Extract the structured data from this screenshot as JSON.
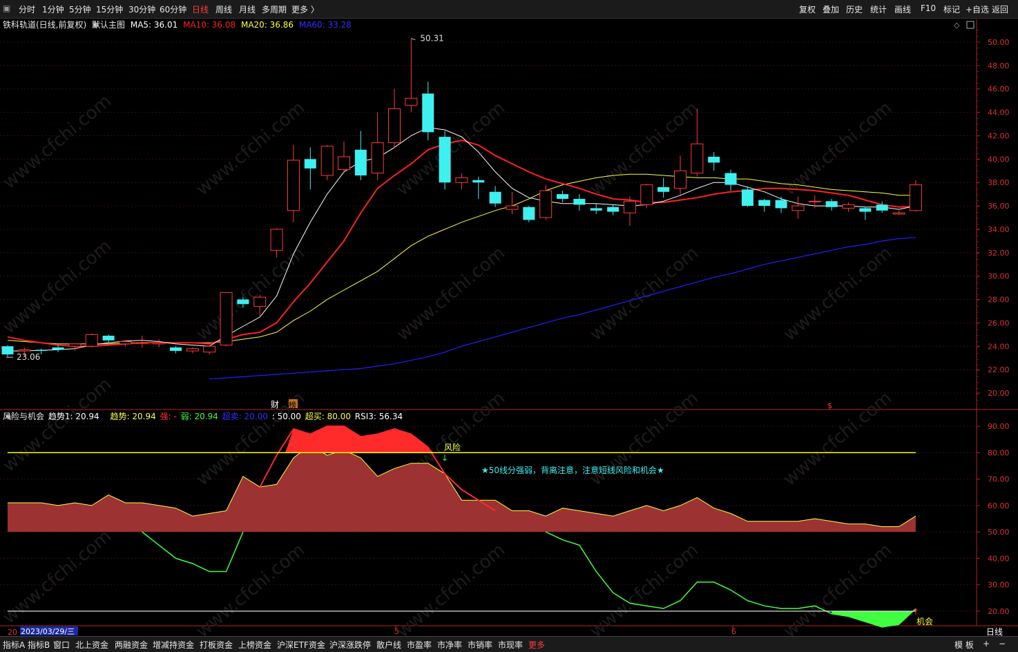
{
  "toolbar": {
    "left": [
      "分时",
      "1分钟",
      "5分钟",
      "15分钟",
      "30分钟",
      "60分钟",
      "日线",
      "周线",
      "月线",
      "多周期",
      "更多 〉"
    ],
    "right": [
      "复权",
      "叠加",
      "历史",
      "统计",
      "画线",
      "F10",
      "标记",
      "+自选",
      "返回"
    ],
    "active": "日线"
  },
  "chart": {
    "stock": "铁科轨道(日线,前复权)",
    "template": "默认主图",
    "ma5": "MA5: 36.01",
    "ma10": "MA10: 36.08",
    "ma20": "MA20: 36.86",
    "ma60": "MA60: 33.28",
    "high_label": "50.31",
    "low_label": "23.06",
    "marks": [
      "财",
      "榜",
      "$"
    ],
    "price_ticks": [
      "50.00",
      "48.00",
      "46.00",
      "44.00",
      "42.00",
      "40.00",
      "38.00",
      "36.00",
      "34.00",
      "32.00",
      "30.00",
      "28.00",
      "26.00",
      "24.00",
      "22.00",
      "20.00"
    ],
    "watermark": "www.cfchi.com"
  },
  "indicator": {
    "name": "风险与机会",
    "trend1": "趋势1: 20.94",
    "trend": "趋势: 20.94",
    "strong": "强: -",
    "weak": "弱: 20.94",
    "oversold": "超卖: 20.00",
    "mid": ": 50.00",
    "overbought": "超买: 80.00",
    "rsi3": "RSI3: 56.34",
    "ticks": [
      "90.00",
      "80.00",
      "70.00",
      "60.00",
      "50.00",
      "40.00",
      "30.00",
      "20.00"
    ],
    "risk_label": "风险",
    "chance_label": "机会",
    "note": "★50线分强弱，背离注意，注意短线风险和机会★"
  },
  "xaxis": {
    "date": "2023/03/29/三",
    "prefix": "20",
    "month5": "5",
    "month6": "6",
    "period": "日线"
  },
  "statusbar": {
    "items": [
      "指标A",
      "指标B",
      "窗口",
      "北上资金",
      "两融资金",
      "增减持资金",
      "打板资金",
      "上榜资金",
      "沪深ETF资金",
      "沪深涨跌停",
      "散户线",
      "市盈率",
      "市净率",
      "市销率",
      "市现率",
      "更多"
    ],
    "right": [
      "模 板",
      "+",
      "−"
    ]
  },
  "colors": {
    "up": "#ff3b3b",
    "down": "#3ef0f0",
    "ma5": "#ffffff",
    "ma10": "#ff2020",
    "ma20": "#ffff40",
    "ma60": "#2020ff",
    "area": "#9c3232",
    "risk": "#ff2a2a",
    "weak_line": "#40ff40",
    "overbought_line": "#ffff00"
  },
  "chart_data": {
    "type": "candlestick",
    "candles": [
      [
        24.0,
        23.3,
        24.1,
        23.1
      ],
      [
        23.6,
        23.7,
        23.9,
        23.1
      ],
      [
        23.7,
        23.6,
        23.8,
        23.3
      ],
      [
        23.9,
        23.7,
        24.1,
        23.5
      ],
      [
        24.0,
        24.2,
        24.2,
        23.6
      ],
      [
        24.0,
        25.0,
        25.1,
        23.9
      ],
      [
        24.9,
        24.5,
        25.0,
        24.3
      ],
      [
        24.2,
        24.4,
        24.5,
        24.0
      ],
      [
        24.3,
        24.3,
        24.9,
        23.9
      ],
      [
        24.2,
        24.3,
        24.6,
        23.9
      ],
      [
        23.9,
        23.6,
        24.0,
        23.4
      ],
      [
        23.6,
        23.8,
        23.9,
        23.4
      ],
      [
        23.5,
        24.0,
        24.1,
        23.3
      ],
      [
        24.1,
        28.6,
        28.6,
        24.0
      ],
      [
        28.0,
        27.6,
        28.2,
        27.3
      ],
      [
        27.4,
        28.2,
        28.4,
        26.6
      ],
      [
        32.2,
        34.0,
        34.1,
        31.6
      ],
      [
        35.6,
        39.9,
        41.2,
        34.6
      ],
      [
        40.0,
        39.2,
        41.0,
        37.4
      ],
      [
        38.6,
        41.1,
        41.2,
        38.2
      ],
      [
        39.1,
        40.2,
        41.5,
        38.8
      ],
      [
        40.8,
        38.6,
        42.4,
        38.2
      ],
      [
        38.8,
        41.4,
        44.0,
        38.2
      ],
      [
        41.4,
        44.3,
        46.0,
        41.0
      ],
      [
        44.6,
        45.2,
        50.31,
        44.0
      ],
      [
        45.6,
        42.3,
        46.6,
        41.6
      ],
      [
        41.9,
        38.0,
        42.4,
        37.4
      ],
      [
        38.0,
        38.4,
        38.8,
        37.4
      ],
      [
        38.2,
        38.0,
        38.5,
        36.6
      ],
      [
        37.2,
        36.2,
        37.7,
        35.9
      ],
      [
        35.7,
        36.0,
        37.2,
        35.3
      ],
      [
        35.9,
        34.8,
        36.0,
        34.6
      ],
      [
        35.0,
        37.3,
        37.8,
        34.8
      ],
      [
        37.0,
        36.6,
        37.3,
        36.3
      ],
      [
        36.6,
        36.1,
        37.0,
        35.6
      ],
      [
        35.8,
        35.6,
        36.2,
        35.3
      ],
      [
        35.9,
        35.5,
        36.1,
        35.2
      ],
      [
        35.4,
        36.4,
        36.8,
        34.3
      ],
      [
        36.1,
        37.8,
        37.9,
        35.8
      ],
      [
        37.6,
        37.2,
        38.4,
        36.7
      ],
      [
        37.5,
        39.0,
        40.3,
        36.8
      ],
      [
        38.8,
        41.3,
        44.3,
        38.5
      ],
      [
        40.2,
        39.7,
        40.6,
        39.0
      ],
      [
        38.8,
        37.8,
        39.1,
        37.3
      ],
      [
        37.4,
        36.0,
        37.6,
        35.9
      ],
      [
        36.5,
        36.0,
        36.6,
        35.5
      ],
      [
        36.5,
        35.8,
        36.8,
        35.4
      ],
      [
        35.6,
        36.0,
        36.8,
        34.9
      ],
      [
        36.4,
        36.4,
        36.9,
        35.8
      ],
      [
        36.4,
        35.9,
        36.6,
        35.6
      ],
      [
        35.8,
        36.1,
        36.3,
        35.5
      ],
      [
        35.8,
        35.5,
        35.9,
        34.8
      ],
      [
        36.1,
        35.6,
        36.4,
        35.4
      ],
      [
        35.3,
        35.4,
        35.6,
        35.2
      ],
      [
        35.6,
        37.8,
        38.2,
        35.5
      ]
    ],
    "ma5": [
      23.6,
      23.6,
      23.65,
      23.7,
      23.8,
      24.1,
      24.3,
      24.45,
      24.5,
      24.4,
      24.2,
      24.1,
      24.0,
      24.9,
      25.7,
      26.5,
      28.3,
      31.9,
      34.6,
      37.0,
      38.9,
      39.8,
      40.1,
      41.0,
      42.0,
      42.7,
      42.5,
      41.9,
      40.6,
      38.9,
      37.5,
      36.7,
      36.4,
      36.2,
      36.2,
      36.2,
      36.1,
      36.0,
      36.1,
      36.4,
      36.9,
      37.5,
      38.0,
      38.0,
      37.6,
      37.2,
      36.6,
      36.2,
      36.0,
      36.0,
      36.0,
      35.9,
      35.9,
      35.7,
      36.0
    ],
    "ma10": [
      24.8,
      24.5,
      24.3,
      24.1,
      24.0,
      24.0,
      24.1,
      24.2,
      24.3,
      24.3,
      24.3,
      24.3,
      24.2,
      24.6,
      25.0,
      25.2,
      26.0,
      27.8,
      29.4,
      31.2,
      33.0,
      35.4,
      37.5,
      38.6,
      39.6,
      40.8,
      41.3,
      41.6,
      41.2,
      40.3,
      39.6,
      38.9,
      38.3,
      37.9,
      37.5,
      37.0,
      36.6,
      36.5,
      36.3,
      36.3,
      36.5,
      36.7,
      37.0,
      37.2,
      37.3,
      37.5,
      37.5,
      37.4,
      37.3,
      37.1,
      36.9,
      36.5,
      36.1,
      35.9,
      35.95
    ],
    "ma20": [
      24.5,
      24.4,
      24.3,
      24.2,
      24.2,
      24.2,
      24.2,
      24.3,
      24.3,
      24.3,
      24.3,
      24.3,
      24.3,
      24.4,
      24.6,
      24.8,
      25.2,
      26.2,
      27.0,
      28.0,
      28.8,
      29.6,
      30.4,
      31.5,
      32.6,
      33.4,
      34.0,
      34.6,
      35.1,
      35.6,
      36.0,
      36.6,
      37.3,
      37.8,
      38.1,
      38.4,
      38.6,
      38.7,
      38.7,
      38.6,
      38.5,
      38.4,
      38.4,
      38.3,
      38.3,
      38.1,
      37.9,
      37.8,
      37.6,
      37.4,
      37.3,
      37.2,
      37.1,
      36.9,
      36.9
    ],
    "ma60": [
      21.2,
      21.3,
      21.4,
      21.5,
      21.6,
      21.7,
      21.8,
      21.9,
      22.0,
      22.1,
      22.3,
      22.5,
      22.8,
      23.1,
      23.5,
      24.0,
      24.4,
      24.8,
      25.2,
      25.6,
      26.0,
      26.4,
      26.7,
      27.1,
      27.5,
      27.9,
      28.3,
      28.7,
      29.1,
      29.5,
      29.9,
      30.2,
      30.6,
      31.0,
      31.3,
      31.6,
      31.9,
      32.2,
      32.5,
      32.7,
      33.0,
      33.2,
      33.3
    ],
    "ma60_start": 12,
    "indicator_area": [
      61,
      61,
      61,
      60,
      61,
      60,
      64,
      61,
      61,
      60,
      59,
      56,
      57,
      58,
      71,
      67,
      68,
      78,
      83,
      79,
      81,
      78,
      71,
      74,
      76,
      76,
      72,
      62,
      62,
      62,
      58,
      58,
      56,
      59,
      58,
      57,
      56,
      58,
      60,
      58,
      60,
      63,
      59,
      57,
      54,
      54,
      54,
      54,
      55,
      54,
      53,
      53,
      52,
      52,
      56
    ],
    "risk_line": [
      null,
      null,
      null,
      null,
      null,
      null,
      null,
      null,
      null,
      null,
      null,
      null,
      null,
      null,
      null,
      67,
      79,
      89,
      87,
      90,
      90,
      86,
      87,
      89,
      87,
      82,
      72,
      66,
      62,
      58,
      null,
      null,
      null,
      null,
      null,
      null,
      null,
      null,
      null,
      null,
      null,
      null,
      null,
      null,
      null,
      null,
      null,
      null,
      null,
      null,
      null,
      null,
      null,
      null,
      null
    ],
    "weak_line": [
      null,
      null,
      null,
      null,
      null,
      null,
      null,
      null,
      50,
      45,
      40,
      38,
      35,
      35,
      50,
      null,
      null,
      null,
      null,
      null,
      null,
      null,
      null,
      null,
      null,
      null,
      null,
      null,
      null,
      null,
      null,
      null,
      50,
      47,
      45,
      35,
      27,
      23,
      22,
      21,
      24,
      31,
      31,
      28,
      24,
      22,
      21,
      21,
      22,
      19,
      18,
      16,
      14,
      15,
      20.94
    ],
    "yrange_price": [
      19.0,
      51.0
    ],
    "yrange_ind": [
      15,
      95
    ]
  }
}
